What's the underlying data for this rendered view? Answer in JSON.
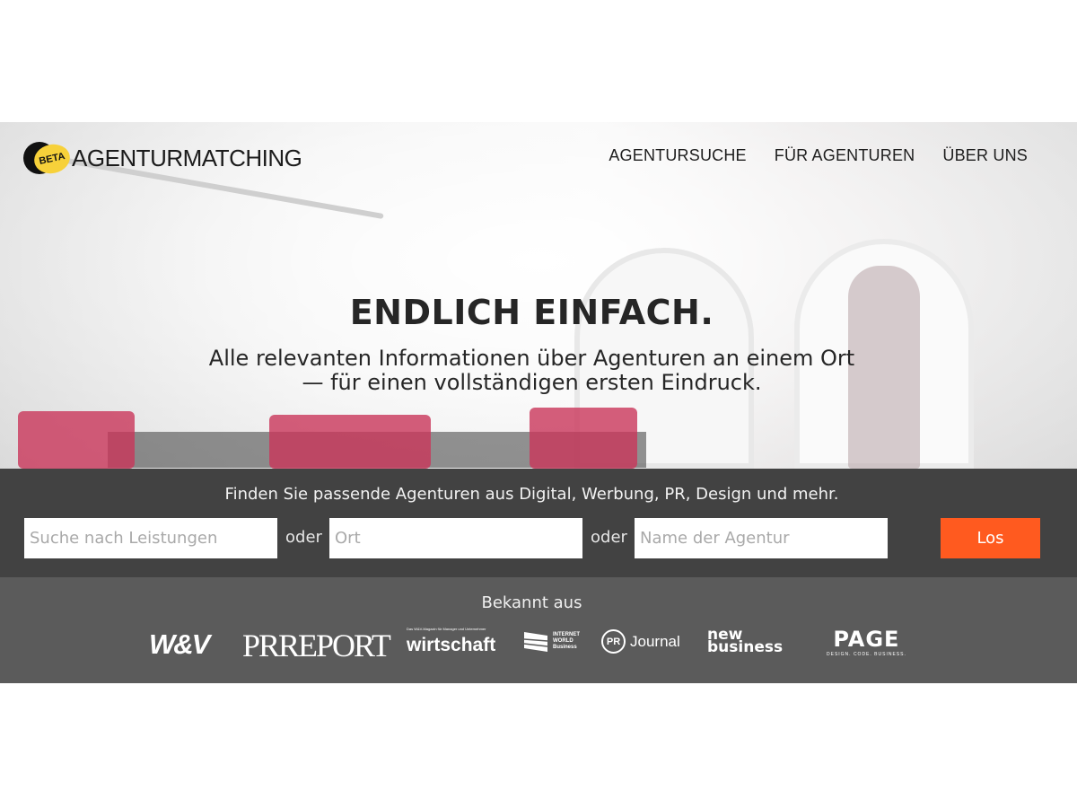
{
  "brand": {
    "badge": "BETA",
    "name": "AGENTURMATCHING"
  },
  "nav": [
    "AGENTURSUCHE",
    "FÜR AGENTUREN",
    "ÜBER UNS"
  ],
  "hero": {
    "headline": "ENDLICH EINFACH.",
    "subline_1": "Alle relevanten Informationen über Agenturen an einem Ort",
    "subline_2": "— für einen vollständigen ersten Eindruck."
  },
  "search": {
    "intro": "Finden Sie passende Agenturen aus Digital, Werbung, PR, Design und mehr.",
    "services_placeholder": "Suche nach Leistungen",
    "or_1": "oder",
    "location_placeholder": "Ort",
    "or_2": "oder",
    "agency_placeholder": "Name der Agentur",
    "submit": "Los"
  },
  "press": {
    "label": "Bekannt aus",
    "logos": {
      "wv": "W&V",
      "prreport": "PRREPORT",
      "wirtschaft_small": "Das W&V-Magazin für Manager und Unternehmer",
      "wirtschaft": "wirtschaft",
      "iwb_1": "INTERNET",
      "iwb_2": "WORLD",
      "iwb_3": "Business",
      "pr_badge": "PR",
      "journal": "Journal",
      "nb_1": "new",
      "nb_2": "business",
      "page": "PAGE",
      "page_sub": "DESIGN. CODE. BUSINESS."
    }
  },
  "colors": {
    "accent": "#ff5a1f",
    "search_bg": "#282828",
    "press_bg": "#5b5b5b",
    "beta_yellow": "#f7d13a"
  }
}
